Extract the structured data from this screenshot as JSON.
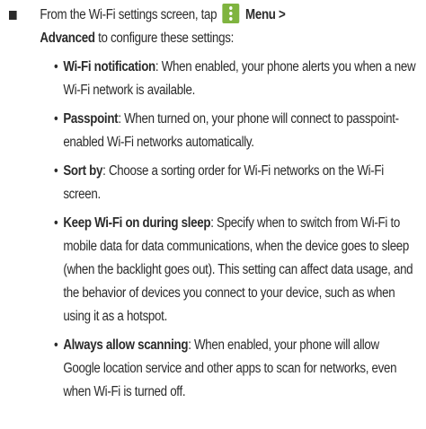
{
  "intro": {
    "prefix": "From the Wi-Fi settings screen, tap",
    "menu_label": "Menu >",
    "advanced_label": "Advanced",
    "suffix": "to configure these settings:"
  },
  "icons": {
    "menu": "menu-icon"
  },
  "colors": {
    "menu_icon_bg": "#7fb43f"
  },
  "items": [
    {
      "term": "Wi-Fi notification",
      "desc": ": When enabled, your phone alerts you when a new Wi-Fi network is available."
    },
    {
      "term": "Passpoint",
      "desc": ": When turned on, your phone will connect to passpoint-enabled Wi-Fi networks automatically."
    },
    {
      "term": "Sort by",
      "desc": ": Choose a sorting order for Wi-Fi networks on the Wi-Fi screen."
    },
    {
      "term": "Keep Wi-Fi on during sleep",
      "desc": ": Specify when to switch from Wi-Fi to mobile data for data communications, when the device goes to sleep (when the backlight goes out). This setting can affect data usage, and the behavior of devices you connect to your device, such as when using it as a hotspot."
    },
    {
      "term": "Always allow scanning",
      "desc": ": When enabled, your phone will allow Google location service and other apps to scan for networks, even when Wi-Fi is turned off."
    }
  ]
}
